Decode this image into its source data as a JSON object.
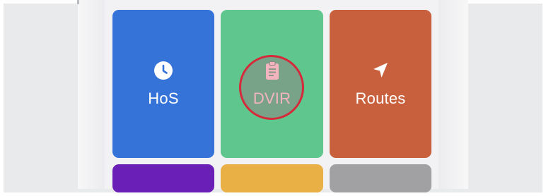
{
  "tiles": [
    {
      "id": "hos",
      "label": "HoS",
      "icon": "clock-icon",
      "color": "#3673d8"
    },
    {
      "id": "dvir",
      "label": "DVIR",
      "icon": "clipboard-icon",
      "color": "#5fc78e",
      "highlighted": true,
      "highlight_color": "#d6293a"
    },
    {
      "id": "routes",
      "label": "Routes",
      "icon": "navigation-arrow-icon",
      "color": "#c9603d"
    },
    {
      "id": "purple",
      "label": "",
      "icon": "",
      "color": "#6a1fb6"
    },
    {
      "id": "yellow",
      "label": "",
      "icon": "",
      "color": "#e8b045"
    },
    {
      "id": "gray",
      "label": "",
      "icon": "",
      "color": "#a1a1a4"
    }
  ]
}
